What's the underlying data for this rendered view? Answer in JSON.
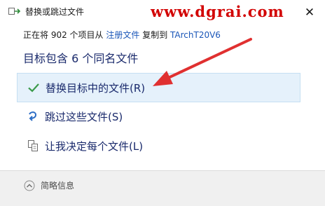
{
  "window": {
    "title": "替换或跳过文件",
    "watermark": "www.dgrai.com",
    "close_glyph": "✕"
  },
  "info": {
    "prefix": "正在将 902 个项目从 ",
    "source": "注册文件",
    "middle": " 复制到 ",
    "destination": "TArchT20V6"
  },
  "heading": "目标包含 6 个同名文件",
  "options": [
    {
      "label": "替换目标中的文件(R)",
      "icon": "checkmark-icon"
    },
    {
      "label": "跳过这些文件(S)",
      "icon": "skip-arrow-icon"
    },
    {
      "label": "让我决定每个文件(L)",
      "icon": "compare-files-icon"
    }
  ],
  "footer": {
    "details_label": "简略信息",
    "icon": "chevron-up-icon"
  },
  "colors": {
    "accent": "#1a56b8",
    "selected_bg": "#e5f1fb",
    "annotation": "#e03030"
  }
}
